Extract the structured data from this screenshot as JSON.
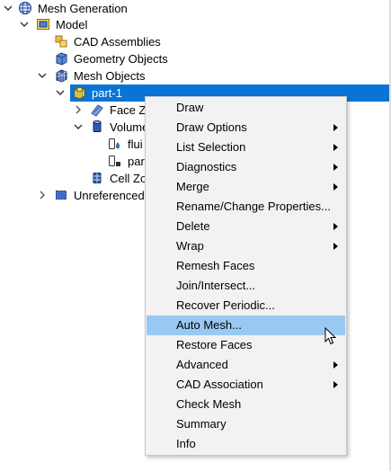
{
  "tree": {
    "root": {
      "label": "Mesh Generation",
      "icon": "globe-icon"
    },
    "model": {
      "label": "Model",
      "icon": "model-icon"
    },
    "cad_assemblies": {
      "label": "CAD Assemblies",
      "icon": "cad-assemblies-icon"
    },
    "geometry_objects": {
      "label": "Geometry Objects",
      "icon": "geometry-cube-icon"
    },
    "mesh_objects": {
      "label": "Mesh Objects",
      "icon": "mesh-cube-icon"
    },
    "part": {
      "label": "part-1",
      "icon": "mesh-part-icon"
    },
    "face_zones": {
      "label": "Face Z",
      "icon": "face-zone-icon"
    },
    "volume": {
      "label": "Volume",
      "icon": "volume-cylinder-icon"
    },
    "fluid": {
      "label": "flui",
      "icon": "fluid-drop-icon"
    },
    "part_vol": {
      "label": "par",
      "icon": "solid-part-icon"
    },
    "cell_zones": {
      "label": "Cell Zo",
      "icon": "cell-zone-icon"
    },
    "unreferenced": {
      "label": "Unreferenced",
      "icon": "unreferenced-icon"
    }
  },
  "context_menu": {
    "items": [
      {
        "label": "Draw",
        "submenu": false
      },
      {
        "label": "Draw Options",
        "submenu": true
      },
      {
        "label": "List Selection",
        "submenu": true
      },
      {
        "label": "Diagnostics",
        "submenu": true
      },
      {
        "label": "Merge",
        "submenu": true
      },
      {
        "label": "Rename/Change Properties...",
        "submenu": false
      },
      {
        "label": "Delete",
        "submenu": true
      },
      {
        "label": "Wrap",
        "submenu": true
      },
      {
        "label": "Remesh Faces",
        "submenu": false
      },
      {
        "label": "Join/Intersect...",
        "submenu": false
      },
      {
        "label": "Recover Periodic...",
        "submenu": false
      },
      {
        "label": "Auto Mesh...",
        "submenu": false
      },
      {
        "label": "Restore Faces",
        "submenu": false
      },
      {
        "label": "Advanced",
        "submenu": true
      },
      {
        "label": "CAD Association",
        "submenu": true
      },
      {
        "label": "Check Mesh",
        "submenu": false
      },
      {
        "label": "Summary",
        "submenu": false
      },
      {
        "label": "Info",
        "submenu": false
      }
    ],
    "hovered_index": 11
  },
  "colors": {
    "selection": "#0a74d6",
    "menu_hover": "#99c9f2",
    "menu_bg": "#f2f2f2"
  }
}
